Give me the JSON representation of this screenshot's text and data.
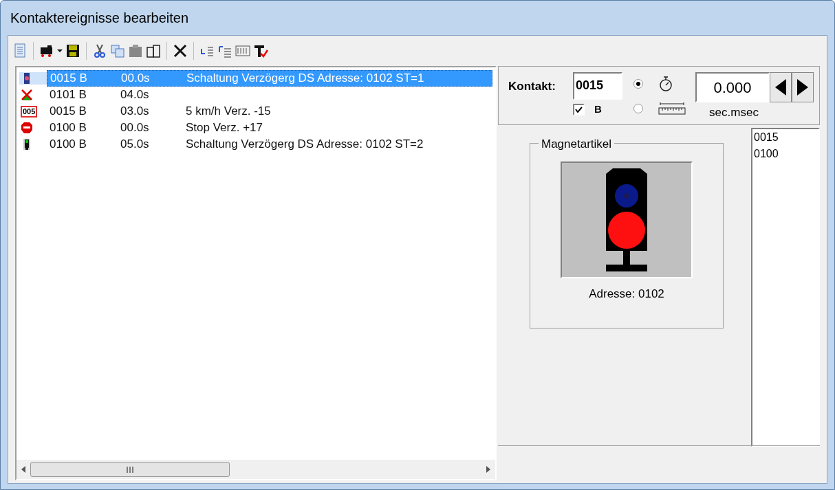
{
  "window": {
    "title": "Kontaktereignisse bearbeiten"
  },
  "events": [
    {
      "kind": "signal_blue",
      "contact": "0015 B",
      "time": "00.0s",
      "text": "Schaltung Verzögerg DS Adresse: 0102 ST=1",
      "selected": true
    },
    {
      "kind": "crossing",
      "contact": "0101 B",
      "time": "04.0s",
      "selected": false
    },
    {
      "kind": "speed",
      "icon_label": "005",
      "contact": "0015 B",
      "time": "03.0s",
      "text": "5 km/h Verz. -15",
      "selected": false
    },
    {
      "kind": "stop",
      "contact": "0100 B",
      "time": "00.0s",
      "text": "Stop Verz. +17",
      "selected": false
    },
    {
      "kind": "signal_green",
      "contact": "0100 B",
      "time": "05.0s",
      "text": "Schaltung Verzögerg DS Adresse: 0102 ST=2",
      "selected": false
    }
  ],
  "kontakt": {
    "label": "Kontakt:",
    "value": "0015",
    "b_checkbox": {
      "label": "B",
      "checked": true
    },
    "modes": [
      {
        "kind": "timer",
        "selected": true
      },
      {
        "kind": "distance",
        "selected": false
      }
    ],
    "delay": {
      "value": "0.000",
      "unit": "sec.msec"
    }
  },
  "magnetartikel": {
    "title": "Magnetartikel",
    "kind": "red_aspect",
    "address": "Adresse: 0102"
  },
  "addresses": [
    "0015",
    "0100"
  ]
}
